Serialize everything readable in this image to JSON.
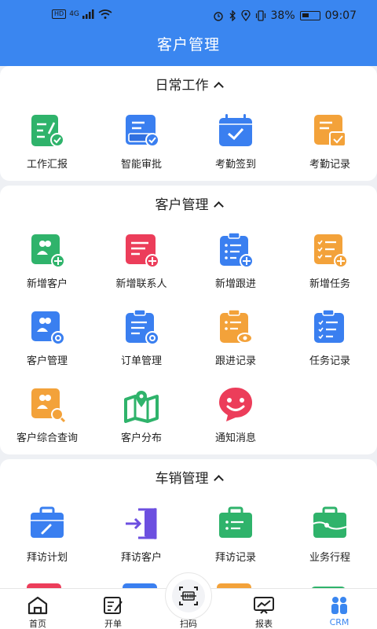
{
  "status": {
    "battery": "38%",
    "time": "09:07",
    "hd": "HD",
    "net": "4G"
  },
  "header": {
    "title": "客户管理"
  },
  "sections": [
    {
      "title": "日常工作",
      "items": [
        {
          "label": "工作汇报",
          "icon": "work-report-icon",
          "color": "#2fb36b"
        },
        {
          "label": "智能审批",
          "icon": "smart-approval-icon",
          "color": "#3a7ff0"
        },
        {
          "label": "考勤签到",
          "icon": "attendance-checkin-icon",
          "color": "#3a7ff0"
        },
        {
          "label": "考勤记录",
          "icon": "attendance-record-icon",
          "color": "#f3a23a"
        }
      ]
    },
    {
      "title": "客户管理",
      "items": [
        {
          "label": "新增客户",
          "icon": "add-customer-icon",
          "color": "#2fb36b"
        },
        {
          "label": "新增联系人",
          "icon": "add-contact-icon",
          "color": "#ec3d5a"
        },
        {
          "label": "新增跟进",
          "icon": "add-followup-icon",
          "color": "#3a7ff0"
        },
        {
          "label": "新增任务",
          "icon": "add-task-icon",
          "color": "#f3a23a"
        },
        {
          "label": "客户管理",
          "icon": "customer-manage-icon",
          "color": "#3a7ff0"
        },
        {
          "label": "订单管理",
          "icon": "order-manage-icon",
          "color": "#3a7ff0"
        },
        {
          "label": "跟进记录",
          "icon": "followup-record-icon",
          "color": "#f3a23a"
        },
        {
          "label": "任务记录",
          "icon": "task-record-icon",
          "color": "#3a7ff0"
        },
        {
          "label": "客户综合查询",
          "icon": "customer-query-icon",
          "color": "#f3a23a"
        },
        {
          "label": "客户分布",
          "icon": "customer-map-icon",
          "color": "#2fb36b"
        },
        {
          "label": "通知消息",
          "icon": "notification-icon",
          "color": "#ec3d5a"
        }
      ]
    },
    {
      "title": "车销管理",
      "items": [
        {
          "label": "拜访计划",
          "icon": "visit-plan-icon",
          "color": "#3a7ff0"
        },
        {
          "label": "拜访客户",
          "icon": "visit-customer-icon",
          "color": "#6c4fe0"
        },
        {
          "label": "拜访记录",
          "icon": "visit-record-icon",
          "color": "#2fb36b"
        },
        {
          "label": "业务行程",
          "icon": "business-trip-icon",
          "color": "#2fb36b"
        }
      ]
    }
  ],
  "tabs": [
    {
      "label": "首页",
      "icon": "home-icon"
    },
    {
      "label": "开单",
      "icon": "order-icon"
    },
    {
      "label": "扫码",
      "icon": "scan-icon"
    },
    {
      "label": "报表",
      "icon": "report-icon"
    },
    {
      "label": "CRM",
      "icon": "crm-icon",
      "active": true
    }
  ]
}
